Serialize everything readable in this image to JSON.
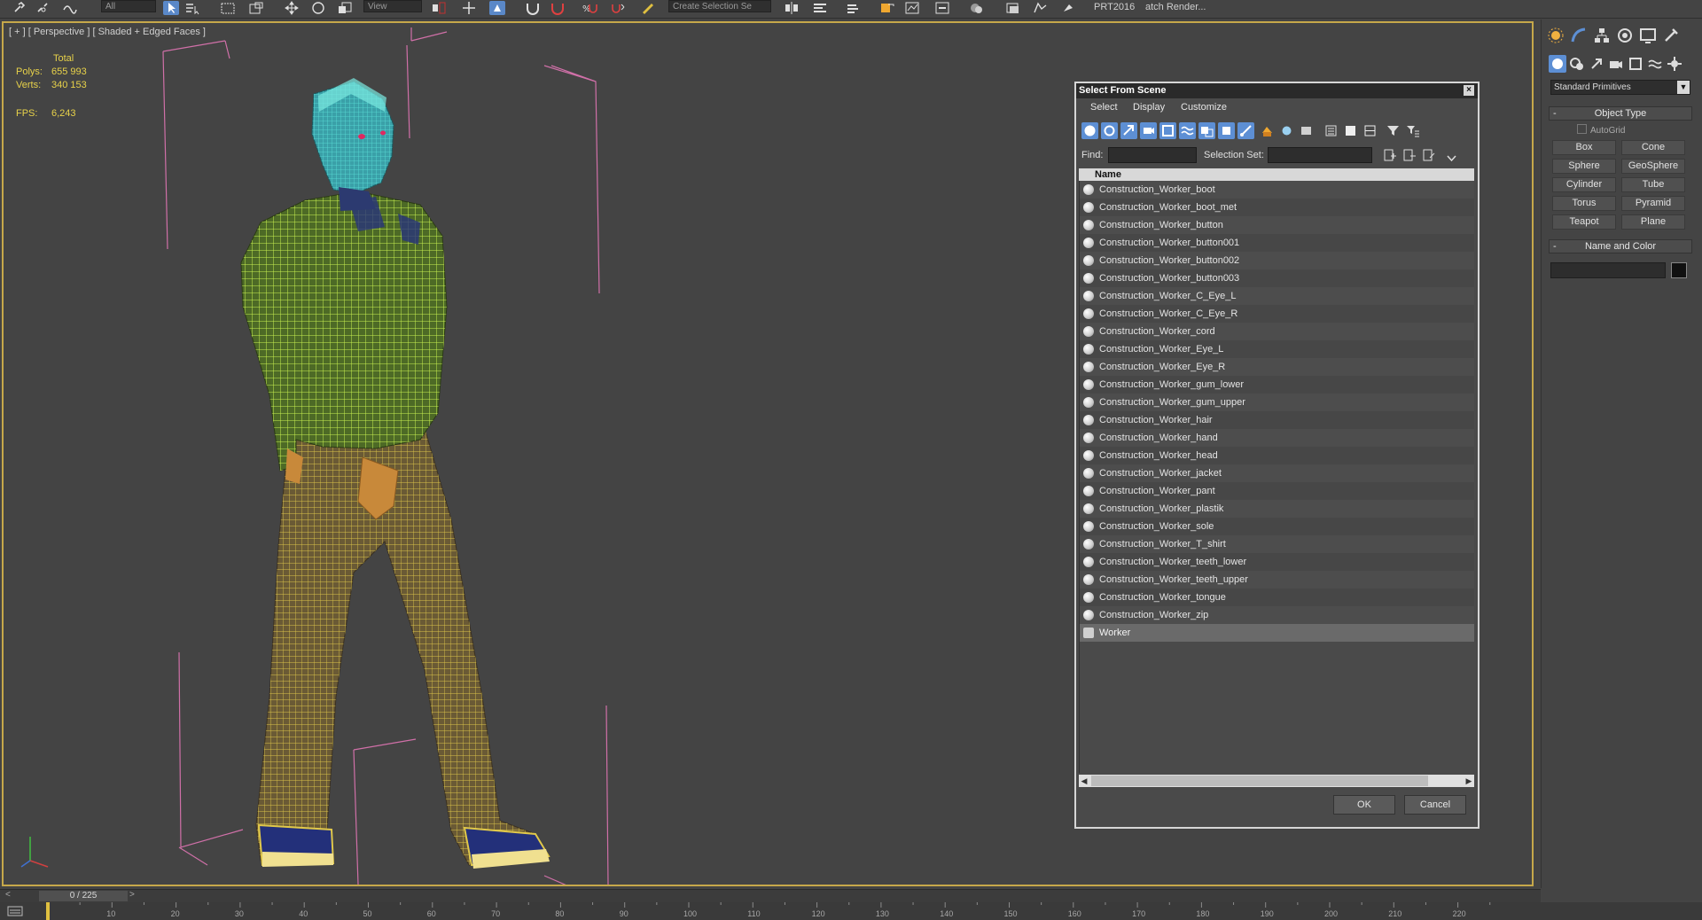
{
  "toolbar": {
    "selection_filter": "All",
    "ref_coord": "View",
    "named_selection": "Create Selection Se",
    "prt_label": "PRT2016",
    "batch_render": "atch Render..."
  },
  "viewport": {
    "label": "[ + ] [ Perspective ] [ Shaded + Edged Faces ]",
    "stats": {
      "total_label": "Total",
      "polys_label": "Polys:",
      "polys_value": "655 993",
      "verts_label": "Verts:",
      "verts_value": "340 153",
      "fps_label": "FPS:",
      "fps_value": "6,243"
    }
  },
  "dialog": {
    "title": "Select From Scene",
    "close_glyph": "×",
    "menu": [
      "Select",
      "Display",
      "Customize"
    ],
    "find_label": "Find:",
    "find_value": "",
    "selection_set_label": "Selection Set:",
    "selection_set_value": "",
    "column_header": "Name",
    "items": [
      "Construction_Worker_boot",
      "Construction_Worker_boot_met",
      "Construction_Worker_button",
      "Construction_Worker_button001",
      "Construction_Worker_button002",
      "Construction_Worker_button003",
      "Construction_Worker_C_Eye_L",
      "Construction_Worker_C_Eye_R",
      "Construction_Worker_cord",
      "Construction_Worker_Eye_L",
      "Construction_Worker_Eye_R",
      "Construction_Worker_gum_lower",
      "Construction_Worker_gum_upper",
      "Construction_Worker_hair",
      "Construction_Worker_hand",
      "Construction_Worker_head",
      "Construction_Worker_jacket",
      "Construction_Worker_pant",
      "Construction_Worker_plastik",
      "Construction_Worker_sole",
      "Construction_Worker_T_shirt",
      "Construction_Worker_teeth_lower",
      "Construction_Worker_teeth_upper",
      "Construction_Worker_tongue",
      "Construction_Worker_zip",
      "Worker"
    ],
    "selected_item": "Worker",
    "ok_label": "OK",
    "cancel_label": "Cancel"
  },
  "panel": {
    "category": "Standard Primitives",
    "object_type_title": "Object Type",
    "autogrid_label": "AutoGrid",
    "buttons": [
      "Box",
      "Cone",
      "Sphere",
      "GeoSphere",
      "Cylinder",
      "Tube",
      "Torus",
      "Pyramid",
      "Teapot",
      "Plane"
    ],
    "name_color_title": "Name and Color",
    "name_value": "",
    "object_color": "#111111"
  },
  "timeslider": {
    "frame_label": "0 / 225",
    "prev_glyph": "<",
    "next_glyph": ">"
  },
  "track": {
    "ticks": [
      "10",
      "20",
      "30",
      "40",
      "50",
      "60",
      "70",
      "80",
      "90",
      "100",
      "110",
      "120",
      "130",
      "140",
      "150",
      "160",
      "170",
      "180",
      "190",
      "200",
      "210",
      "220"
    ]
  },
  "colors": {
    "viewport_border": "#c6a84a",
    "stats_text": "#e8d24a",
    "active_tool": "#5d8fd4",
    "bounding_box": "#d070a8"
  },
  "icons": {
    "toolbar": [
      "link-icon",
      "unlink-icon",
      "bind-spacewarp-icon",
      "select-object-icon",
      "select-by-name-icon",
      "rect-region-icon",
      "window-crossing-icon",
      "move-icon",
      "rotate-icon",
      "scale-icon",
      "mirror-icon",
      "align-icon",
      "snap-icon",
      "angle-snap-icon",
      "percent-snap-icon",
      "spinner-snap-icon",
      "edit-named-sets-icon",
      "curve-editor-icon",
      "schematic-view-icon",
      "material-editor-icon",
      "render-setup-icon",
      "render-frame-icon",
      "render-icon",
      "render-iterative-icon",
      "activeshade-icon"
    ],
    "dialog_tools": [
      "display-geometry-icon",
      "display-shapes-icon",
      "display-lights-icon",
      "display-cameras-icon",
      "display-helpers-icon",
      "display-spacewarps-icon",
      "display-groups-icon",
      "display-xrefs-icon",
      "display-bones-icon",
      "display-containers-icon",
      "display-frozen-icon",
      "display-hidden-icon",
      "select-all-icon",
      "select-none-icon",
      "invert-selection-icon",
      "filter-icon",
      "filter-options-icon"
    ],
    "panel_tabs": [
      "create-tab-icon",
      "modify-tab-icon",
      "hierarchy-tab-icon",
      "motion-tab-icon",
      "display-tab-icon",
      "utilities-tab-icon"
    ],
    "panel_categories": [
      "geometry-icon",
      "shapes-icon",
      "lights-icon",
      "cameras-icon",
      "helpers-icon",
      "spacewarps-icon",
      "systems-icon"
    ]
  }
}
